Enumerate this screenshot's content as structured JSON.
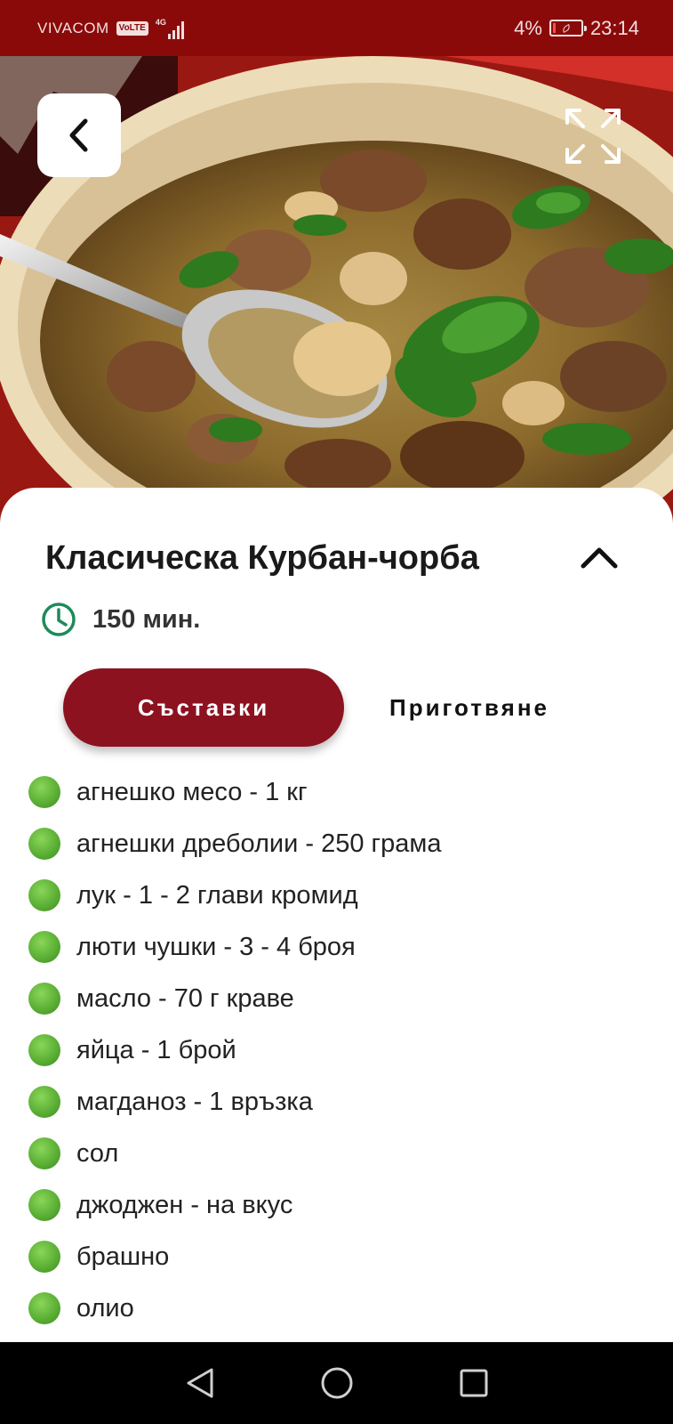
{
  "status_bar": {
    "carrier": "VIVACOM",
    "volte": "VoLTE",
    "network": "4G",
    "battery": "4%",
    "time": "23:14"
  },
  "hero": {
    "back_icon": "chevron-left-icon",
    "expand_icon": "expand-icon"
  },
  "recipe": {
    "title": "Класическа Курбан-чорба",
    "time": "150 мин.",
    "collapse_icon": "chevron-up-icon"
  },
  "tabs": {
    "ingredients": "Съставки",
    "preparation": "Приготвяне"
  },
  "ingredients": [
    "агнешко месо - 1 кг",
    "агнешки дреболии - 250 грама",
    "лук - 1 - 2 глави кромид",
    "люти чушки - 3 - 4 броя",
    "масло - 70 г краве",
    "яйца - 1 брой",
    "магданоз - 1 връзка",
    "сол",
    "джоджен - на вкус",
    "брашно",
    "олио"
  ],
  "colors": {
    "status_bar": "#8a0a0a",
    "accent": "#8c1220",
    "bullet": "#5bb035",
    "clock": "#1e8a5a"
  },
  "nav": {
    "back": "back-triangle-icon",
    "home": "home-circle-icon",
    "recents": "recents-square-icon"
  }
}
